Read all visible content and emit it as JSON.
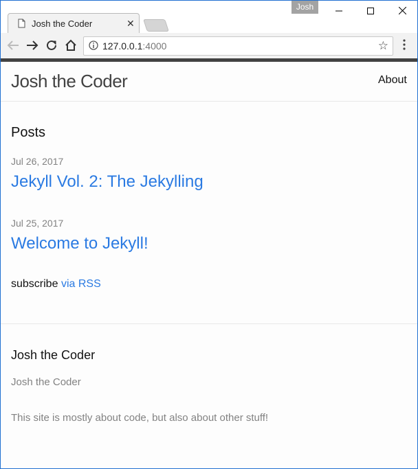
{
  "window": {
    "profile_name": "Josh"
  },
  "tab": {
    "title": "Josh the Coder"
  },
  "toolbar": {
    "url_host": "127.0.0.1",
    "url_port": ":4000"
  },
  "site": {
    "title": "Josh the Coder",
    "nav": {
      "about_label": "About"
    },
    "posts_heading": "Posts",
    "posts": [
      {
        "date": "Jul 26, 2017",
        "title": "Jekyll Vol. 2: The Jekylling"
      },
      {
        "date": "Jul 25, 2017",
        "title": "Welcome to Jekyll!"
      }
    ],
    "subscribe": {
      "text": "subscribe",
      "link_label": "via RSS"
    },
    "footer": {
      "heading": "Josh the Coder",
      "name": "Josh the Coder",
      "description": "This site is mostly about code, but also about other stuff!"
    }
  },
  "colors": {
    "link": "#2a7ae2",
    "muted": "#828282",
    "header_bar": "#424242"
  }
}
